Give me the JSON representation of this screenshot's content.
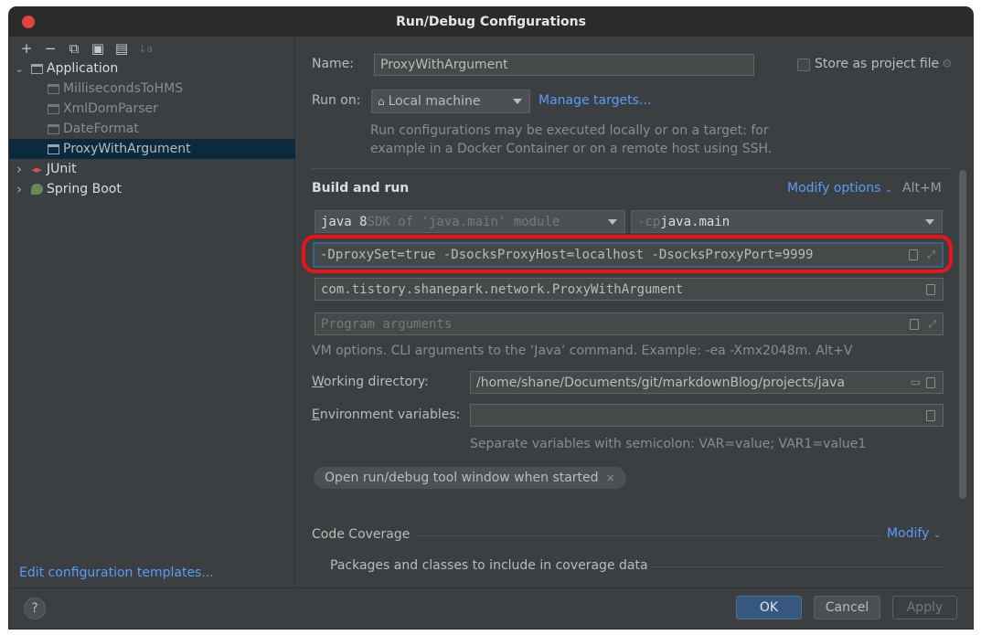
{
  "window": {
    "title": "Run/Debug Configurations"
  },
  "toolbar": {
    "add": "+",
    "remove": "−",
    "copy": "⧉",
    "save": "▣",
    "folder": "▤",
    "sort": "↓a"
  },
  "tree": {
    "application": {
      "label": "Application",
      "arrow": "⌄"
    },
    "children": [
      {
        "label": "MillisecondsToHMS",
        "dim": true
      },
      {
        "label": "XmlDomParser",
        "dim": true
      },
      {
        "label": "DateFormat",
        "dim": true
      },
      {
        "label": "ProxyWithArgument",
        "dim": false,
        "selected": true
      }
    ],
    "junit": {
      "label": "JUnit",
      "arrow": "›"
    },
    "spring_boot": {
      "label": "Spring Boot",
      "arrow": "›"
    }
  },
  "left_footer": {
    "edit_templates": "Edit configuration templates..."
  },
  "form": {
    "name_label": "Name:",
    "name_value": "ProxyWithArgument",
    "store_as_project_file": "Store as project file",
    "run_on_label": "Run on:",
    "run_on_value": "Local machine",
    "manage_targets": "Manage targets...",
    "run_on_hint": "Run configurations may be executed locally or on a target: for example in a Docker Container or on a remote host using SSH.",
    "build_and_run_title": "Build and run",
    "modify_options": "Modify options",
    "modify_options_shortcut": "Alt+M",
    "jdk_bold": "java 8",
    "jdk_rest": " SDK of 'java.main' module",
    "cp_prefix": "-cp ",
    "cp_value": "java.main",
    "vm_options": "-DproxySet=true -DsocksProxyHost=localhost -DsocksProxyPort=9999",
    "main_class": "com.tistory.shanepark.network.ProxyWithArgument",
    "program_args_placeholder": "Program arguments",
    "vm_hint": "VM options. CLI arguments to the ‘Java’ command. Example: -ea -Xmx2048m. Alt+V",
    "working_dir_label": "Working directory:",
    "working_dir_value": "/home/shane/Documents/git/markdownBlog/projects/java",
    "env_vars_label": "Environment variables:",
    "env_vars_value": "",
    "env_vars_hint": "Separate variables with semicolon: VAR=value; VAR1=value1",
    "chip_open_tool_window": "Open run/debug tool window when started",
    "chip_close": "×",
    "code_coverage_title": "Code Coverage",
    "modify": "Modify",
    "coverage_packages": "Packages and classes to include in coverage data"
  },
  "buttons": {
    "help": "?",
    "ok": "OK",
    "cancel": "Cancel",
    "apply": "Apply"
  },
  "colors": {
    "highlight": "#e8141c",
    "link": "#589df6",
    "ok": "#365880"
  }
}
